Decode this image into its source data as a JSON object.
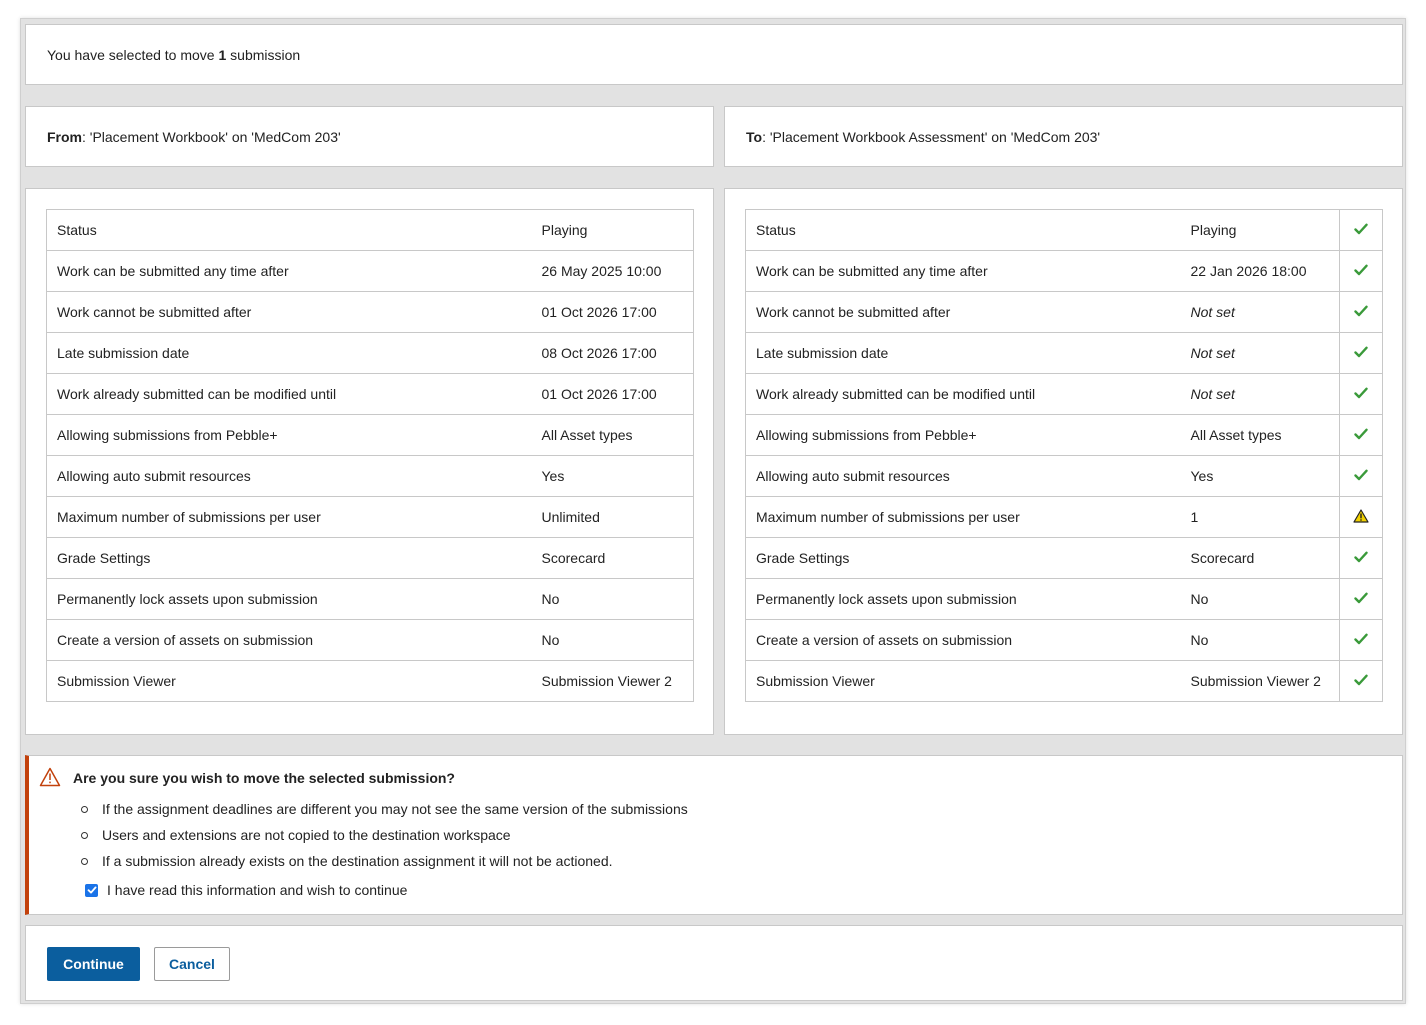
{
  "summary": {
    "prefix": "You have selected to move ",
    "count": "1",
    "suffix": " submission"
  },
  "from": {
    "label": "From",
    "text": ": 'Placement Workbook' on 'MedCom 203'"
  },
  "to": {
    "label": "To",
    "text": ": 'Placement Workbook Assessment' on 'MedCom 203'"
  },
  "source_rows": [
    {
      "label": "Status",
      "value": "Playing"
    },
    {
      "label": "Work can be submitted any time after",
      "value": "26 May 2025 10:00"
    },
    {
      "label": "Work cannot be submitted after",
      "value": "01 Oct 2026 17:00"
    },
    {
      "label": "Late submission date",
      "value": "08 Oct 2026 17:00"
    },
    {
      "label": "Work already submitted can be modified until",
      "value": "01 Oct 2026 17:00"
    },
    {
      "label": "Allowing submissions from Pebble+",
      "value": "All Asset types"
    },
    {
      "label": "Allowing auto submit resources",
      "value": "Yes"
    },
    {
      "label": "Maximum number of submissions per user",
      "value": "Unlimited"
    },
    {
      "label": "Grade Settings",
      "value": "Scorecard"
    },
    {
      "label": "Permanently lock assets upon submission",
      "value": "No"
    },
    {
      "label": "Create a version of assets on submission",
      "value": "No"
    },
    {
      "label": "Submission Viewer",
      "value": "Submission Viewer 2"
    }
  ],
  "dest_rows": [
    {
      "label": "Status",
      "value": "Playing",
      "status": "check-icon"
    },
    {
      "label": "Work can be submitted any time after",
      "value": "22 Jan 2026 18:00",
      "status": "check-icon"
    },
    {
      "label": "Work cannot be submitted after",
      "value": "Not set",
      "status": "check-icon"
    },
    {
      "label": "Late submission date",
      "value": "Not set",
      "status": "check-icon"
    },
    {
      "label": "Work already submitted can be modified until",
      "value": "Not set",
      "status": "check-icon"
    },
    {
      "label": "Allowing submissions from Pebble+",
      "value": "All Asset types",
      "status": "check-icon"
    },
    {
      "label": "Allowing auto submit resources",
      "value": "Yes",
      "status": "check-icon"
    },
    {
      "label": "Maximum number of submissions per user",
      "value": "1",
      "status": "warning-icon"
    },
    {
      "label": "Grade Settings",
      "value": "Scorecard",
      "status": "check-icon"
    },
    {
      "label": "Permanently lock assets upon submission",
      "value": "No",
      "status": "check-icon"
    },
    {
      "label": "Create a version of assets on submission",
      "value": "No",
      "status": "check-icon"
    },
    {
      "label": "Submission Viewer",
      "value": "Submission Viewer 2",
      "status": "check-icon"
    }
  ],
  "alert": {
    "title": "Are you sure you wish to move the selected submission?",
    "items": [
      "If the assignment deadlines are different you may not see the same version of the submissions",
      "Users and extensions are not copied to the destination workspace",
      "If a submission already exists on the destination assignment it will not be actioned."
    ],
    "confirm_label": "I have read this information and wish to continue",
    "confirm_checked": true
  },
  "actions": {
    "continue_label": "Continue",
    "cancel_label": "Cancel"
  },
  "colors": {
    "primary": "#0b5e9e",
    "alert_border": "#c2410c",
    "check": "#3a9a3a",
    "warning": "#f0d000"
  }
}
